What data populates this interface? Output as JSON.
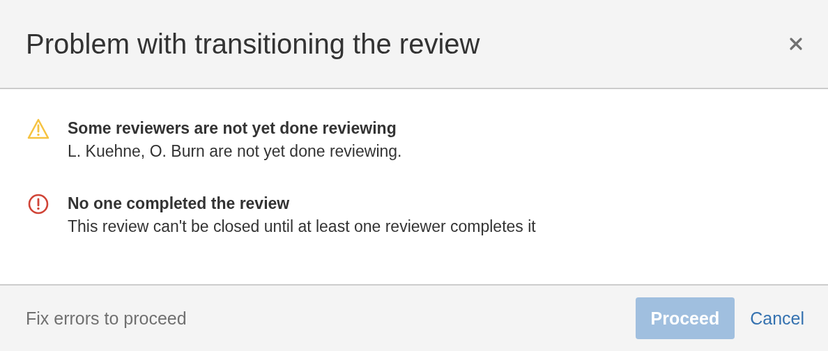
{
  "dialog": {
    "title": "Problem with transitioning the review"
  },
  "messages": [
    {
      "kind": "warning",
      "title": "Some reviewers are not yet done reviewing",
      "text": "L. Kuehne, O. Burn are not yet done reviewing."
    },
    {
      "kind": "error",
      "title": "No one completed the review",
      "text": "This review can't be closed until at least one reviewer completes it"
    }
  ],
  "footer": {
    "hint": "Fix errors to proceed",
    "buttons": [
      {
        "kind": "primary",
        "label": "Proceed",
        "disabled": true
      },
      {
        "kind": "link",
        "label": "Cancel",
        "disabled": false
      }
    ]
  }
}
